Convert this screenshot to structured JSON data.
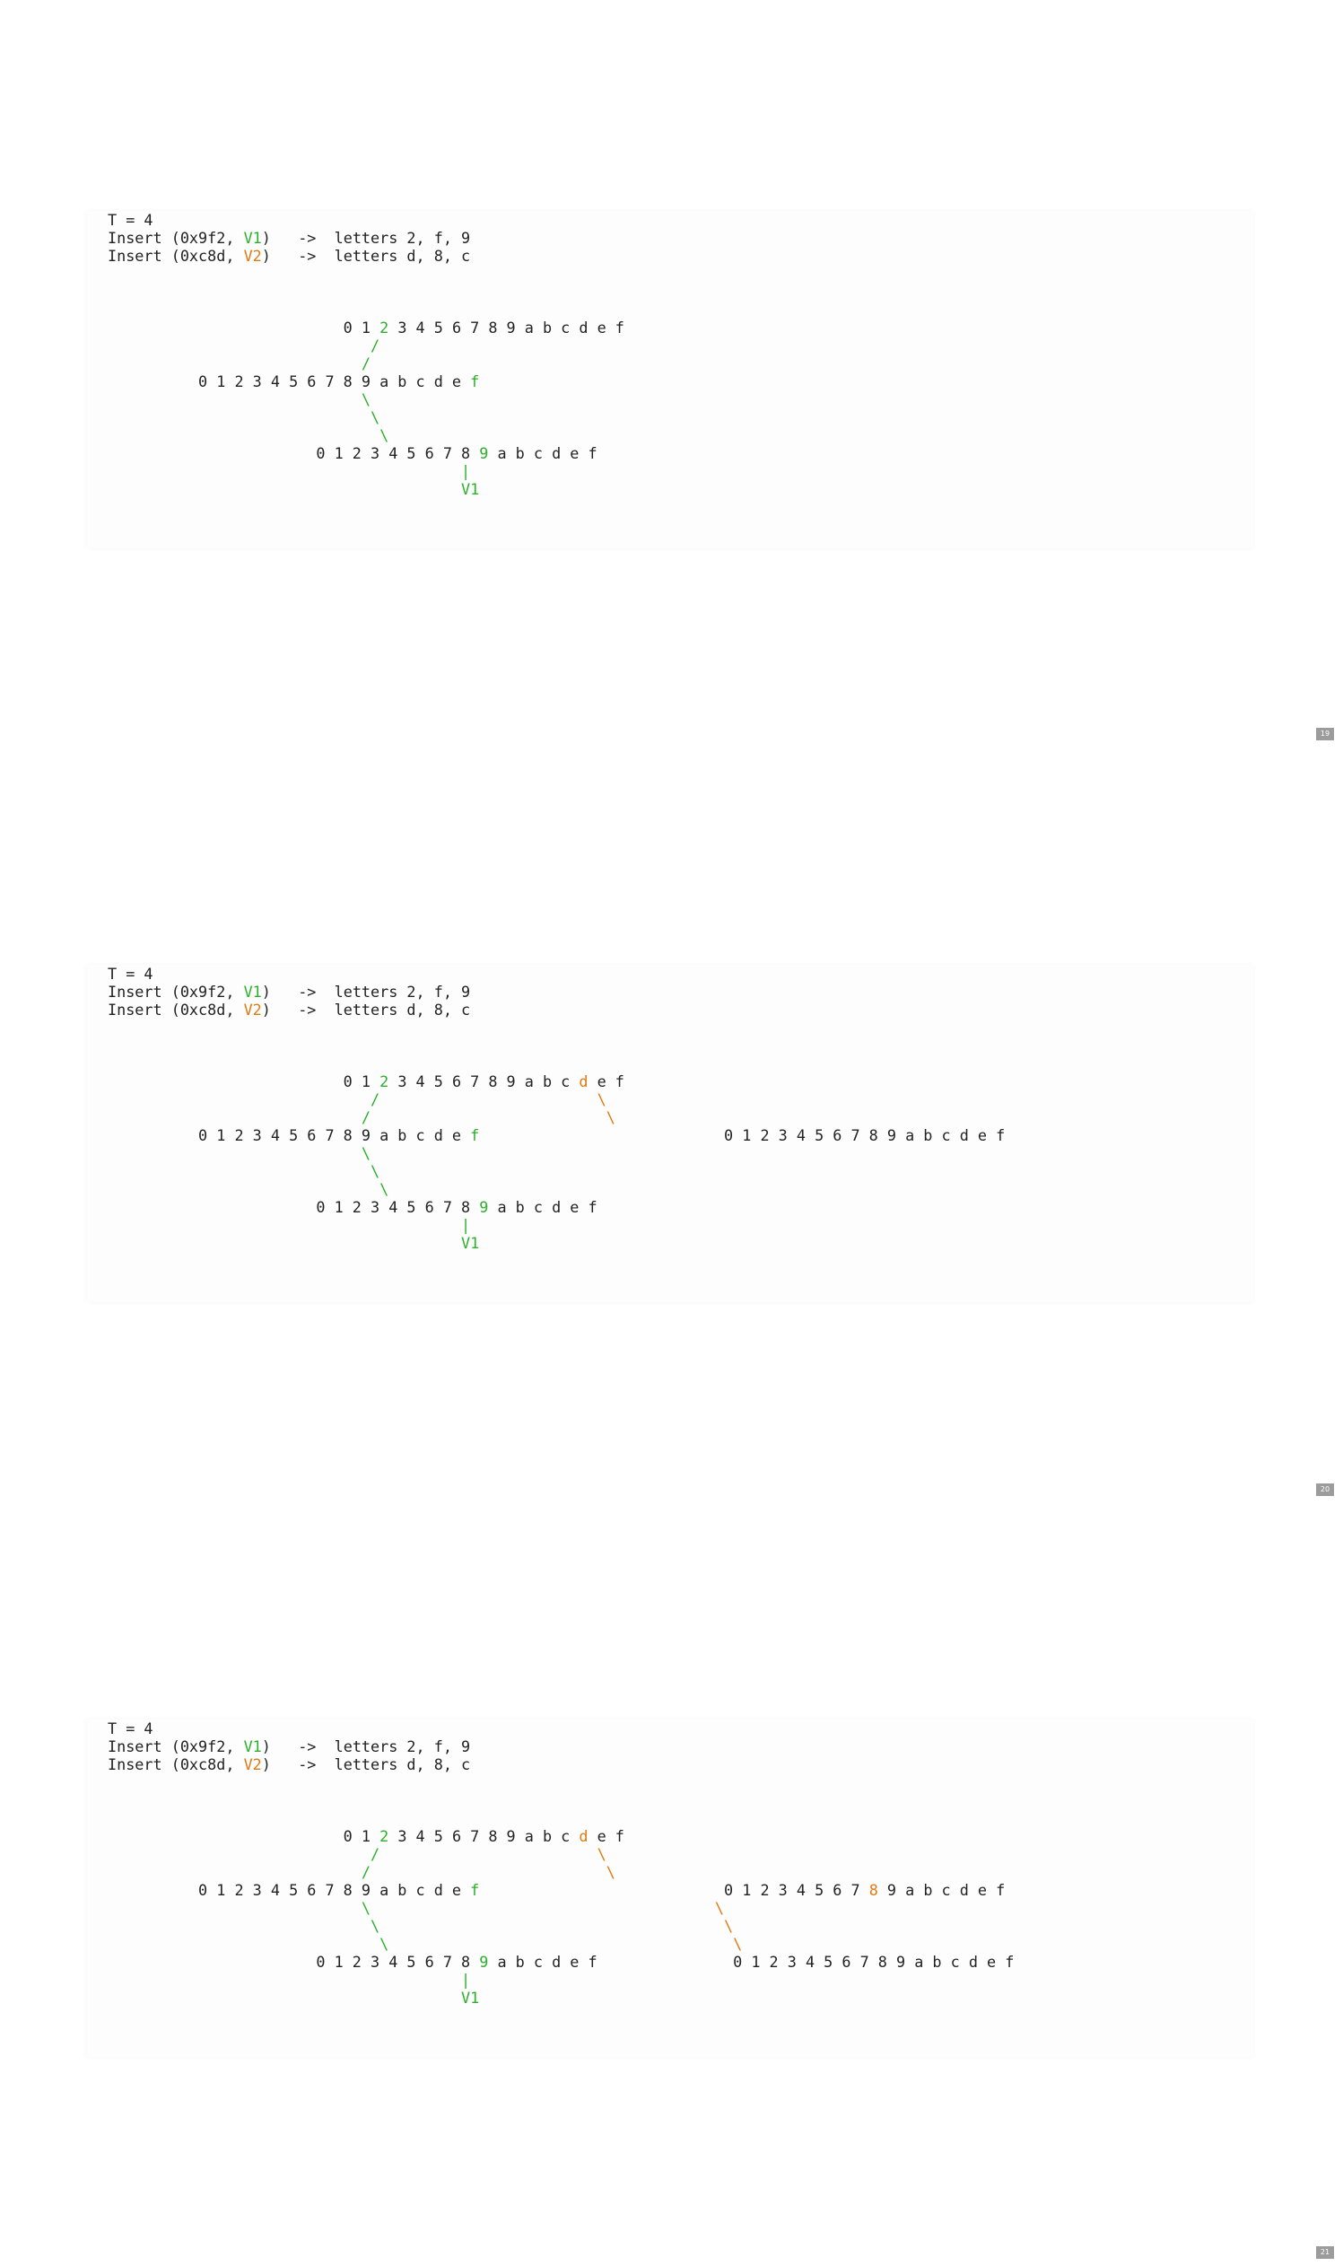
{
  "slides": [
    {
      "page_number": "19",
      "lines": [
        [
          [
            "T = 4",
            ""
          ]
        ],
        [
          [
            "Insert (0x9f2, ",
            ""
          ],
          [
            "V1",
            "green"
          ],
          [
            ")   ->  letters 2, f, 9",
            ""
          ]
        ],
        [
          [
            "Insert (0xc8d, ",
            ""
          ],
          [
            "V2",
            "orange"
          ],
          [
            ")   ->  letters d, 8, c",
            ""
          ]
        ],
        [
          [
            "",
            ""
          ]
        ],
        [
          [
            "",
            ""
          ]
        ],
        [
          [
            "",
            ""
          ]
        ],
        [
          [
            "                          0 1 ",
            ""
          ],
          [
            "2",
            "green"
          ],
          [
            " 3 4 5 6 7 8 9 a b c d e f",
            ""
          ]
        ],
        [
          [
            "                             ",
            ""
          ],
          [
            "/",
            "green"
          ]
        ],
        [
          [
            "                            ",
            ""
          ],
          [
            "/",
            "green"
          ]
        ],
        [
          [
            "          0 1 2 3 4 5 6 7 8 9 a b c d e ",
            ""
          ],
          [
            "f",
            "green"
          ]
        ],
        [
          [
            "                            ",
            ""
          ],
          [
            "\\",
            "green"
          ]
        ],
        [
          [
            "                             ",
            ""
          ],
          [
            "\\",
            "green"
          ]
        ],
        [
          [
            "                              ",
            ""
          ],
          [
            "\\",
            "green"
          ]
        ],
        [
          [
            "                       0 1 2 3 4 5 6 7 8 ",
            ""
          ],
          [
            "9",
            "green"
          ],
          [
            " a b c d e f",
            ""
          ]
        ],
        [
          [
            "                                       ",
            ""
          ],
          [
            "|",
            "green"
          ]
        ],
        [
          [
            "                                       ",
            ""
          ],
          [
            "V1",
            "green"
          ]
        ]
      ]
    },
    {
      "page_number": "20",
      "lines": [
        [
          [
            "T = 4",
            ""
          ]
        ],
        [
          [
            "Insert (0x9f2, ",
            ""
          ],
          [
            "V1",
            "green"
          ],
          [
            ")   ->  letters 2, f, 9",
            ""
          ]
        ],
        [
          [
            "Insert (0xc8d, ",
            ""
          ],
          [
            "V2",
            "orange"
          ],
          [
            ")   ->  letters d, 8, c",
            ""
          ]
        ],
        [
          [
            "",
            ""
          ]
        ],
        [
          [
            "",
            ""
          ]
        ],
        [
          [
            "",
            ""
          ]
        ],
        [
          [
            "                          0 1 ",
            ""
          ],
          [
            "2",
            "green"
          ],
          [
            " 3 4 5 6 7 8 9 a b c ",
            ""
          ],
          [
            "d",
            "orange"
          ],
          [
            " e f",
            ""
          ]
        ],
        [
          [
            "                             ",
            ""
          ],
          [
            "/",
            "green"
          ],
          [
            "                        ",
            ""
          ],
          [
            "\\",
            "orange"
          ]
        ],
        [
          [
            "                            ",
            ""
          ],
          [
            "/",
            "green"
          ],
          [
            "                          ",
            ""
          ],
          [
            "\\",
            "orange"
          ]
        ],
        [
          [
            "          0 1 2 3 4 5 6 7 8 9 a b c d e ",
            ""
          ],
          [
            "f",
            "green"
          ],
          [
            "                           0 1 2 3 4 5 6 7 8 9 a b c d e f",
            ""
          ]
        ],
        [
          [
            "                            ",
            ""
          ],
          [
            "\\",
            "green"
          ]
        ],
        [
          [
            "                             ",
            ""
          ],
          [
            "\\",
            "green"
          ]
        ],
        [
          [
            "                              ",
            ""
          ],
          [
            "\\",
            "green"
          ]
        ],
        [
          [
            "                       0 1 2 3 4 5 6 7 8 ",
            ""
          ],
          [
            "9",
            "green"
          ],
          [
            " a b c d e f",
            ""
          ]
        ],
        [
          [
            "                                       ",
            ""
          ],
          [
            "|",
            "green"
          ]
        ],
        [
          [
            "                                       ",
            ""
          ],
          [
            "V1",
            "green"
          ]
        ]
      ]
    },
    {
      "page_number": "21",
      "lines": [
        [
          [
            "T = 4",
            ""
          ]
        ],
        [
          [
            "Insert (0x9f2, ",
            ""
          ],
          [
            "V1",
            "green"
          ],
          [
            ")   ->  letters 2, f, 9",
            ""
          ]
        ],
        [
          [
            "Insert (0xc8d, ",
            ""
          ],
          [
            "V2",
            "orange"
          ],
          [
            ")   ->  letters d, 8, c",
            ""
          ]
        ],
        [
          [
            "",
            ""
          ]
        ],
        [
          [
            "",
            ""
          ]
        ],
        [
          [
            "",
            ""
          ]
        ],
        [
          [
            "                          0 1 ",
            ""
          ],
          [
            "2",
            "green"
          ],
          [
            " 3 4 5 6 7 8 9 a b c ",
            ""
          ],
          [
            "d",
            "orange"
          ],
          [
            " e f",
            ""
          ]
        ],
        [
          [
            "                             ",
            ""
          ],
          [
            "/",
            "green"
          ],
          [
            "                        ",
            ""
          ],
          [
            "\\",
            "orange"
          ]
        ],
        [
          [
            "                            ",
            ""
          ],
          [
            "/",
            "green"
          ],
          [
            "                          ",
            ""
          ],
          [
            "\\",
            "orange"
          ]
        ],
        [
          [
            "          0 1 2 3 4 5 6 7 8 9 a b c d e ",
            ""
          ],
          [
            "f",
            "green"
          ],
          [
            "                           0 1 2 3 4 5 6 7 ",
            ""
          ],
          [
            "8",
            "orange"
          ],
          [
            " 9 a b c d e f",
            ""
          ]
        ],
        [
          [
            "                            ",
            ""
          ],
          [
            "\\",
            "green"
          ],
          [
            "                                      ",
            ""
          ],
          [
            "\\",
            "orange"
          ]
        ],
        [
          [
            "                             ",
            ""
          ],
          [
            "\\",
            "green"
          ],
          [
            "                                      ",
            ""
          ],
          [
            "\\",
            "orange"
          ]
        ],
        [
          [
            "                              ",
            ""
          ],
          [
            "\\",
            "green"
          ],
          [
            "                                      ",
            ""
          ],
          [
            "\\",
            "orange"
          ]
        ],
        [
          [
            "                       0 1 2 3 4 5 6 7 8 ",
            ""
          ],
          [
            "9",
            "green"
          ],
          [
            " a b c d e f",
            ""
          ],
          [
            "               0 1 2 3 4 5 6 7 8 9 a b c d e f",
            ""
          ]
        ],
        [
          [
            "                                       ",
            ""
          ],
          [
            "|",
            "green"
          ]
        ],
        [
          [
            "                                       ",
            ""
          ],
          [
            "V1",
            "green"
          ]
        ]
      ]
    }
  ],
  "colors": {
    "v1_green": "#2ab12a",
    "v2_orange": "#e07a10",
    "text": "#222222",
    "page_badge": "#9c9c9c"
  }
}
